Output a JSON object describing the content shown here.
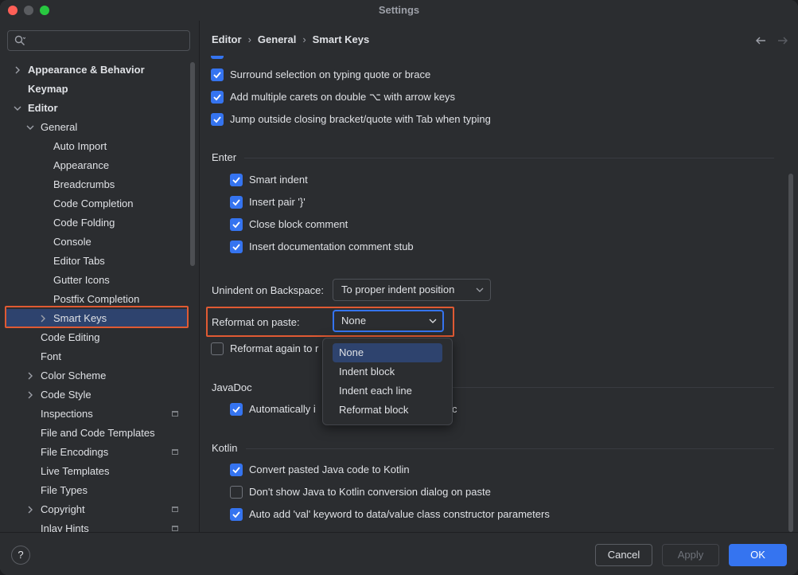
{
  "window": {
    "title": "Settings"
  },
  "search": {
    "placeholder": ""
  },
  "breadcrumb": [
    "Editor",
    "General",
    "Smart Keys"
  ],
  "sidebar": {
    "items": [
      {
        "label": "Appearance & Behavior"
      },
      {
        "label": "Keymap"
      },
      {
        "label": "Editor"
      },
      {
        "label": "General"
      },
      {
        "label": "Auto Import"
      },
      {
        "label": "Appearance"
      },
      {
        "label": "Breadcrumbs"
      },
      {
        "label": "Code Completion"
      },
      {
        "label": "Code Folding"
      },
      {
        "label": "Console"
      },
      {
        "label": "Editor Tabs"
      },
      {
        "label": "Gutter Icons"
      },
      {
        "label": "Postfix Completion"
      },
      {
        "label": "Smart Keys"
      },
      {
        "label": "Code Editing"
      },
      {
        "label": "Font"
      },
      {
        "label": "Color Scheme"
      },
      {
        "label": "Code Style"
      },
      {
        "label": "Inspections"
      },
      {
        "label": "File and Code Templates"
      },
      {
        "label": "File Encodings"
      },
      {
        "label": "Live Templates"
      },
      {
        "label": "File Types"
      },
      {
        "label": "Copyright"
      },
      {
        "label": "Inlay Hints"
      }
    ]
  },
  "options": {
    "surround_selection": {
      "label": "Surround selection on typing quote or brace",
      "checked": true
    },
    "multiple_carets": {
      "label": "Add multiple carets on double ⌥ with arrow keys",
      "checked": true
    },
    "jump_outside": {
      "label": "Jump outside closing bracket/quote with Tab when typing",
      "checked": true
    }
  },
  "enter": {
    "title": "Enter",
    "smart_indent": {
      "label": "Smart indent",
      "checked": true
    },
    "insert_pair": {
      "label": "Insert pair '}'",
      "checked": true
    },
    "close_block_comment": {
      "label": "Close block comment",
      "checked": true
    },
    "insert_doc_stub": {
      "label": "Insert documentation comment stub",
      "checked": true
    }
  },
  "unindent": {
    "label": "Unindent on Backspace:",
    "value": "To proper indent position"
  },
  "reformat": {
    "label": "Reformat on paste:",
    "value": "None",
    "options": [
      "None",
      "Indent block",
      "Indent each line",
      "Reformat block"
    ],
    "again_label": "Reformat again to r",
    "again_checked": false
  },
  "javadoc": {
    "title": "JavaDoc",
    "auto_label_start": "Automatically i",
    "auto_label_end": "c",
    "checked": true
  },
  "kotlin": {
    "title": "Kotlin",
    "convert_java": {
      "label": "Convert pasted Java code to Kotlin",
      "checked": true
    },
    "dont_show_dialog": {
      "label": "Don't show Java to Kotlin conversion dialog on paste",
      "checked": false
    },
    "auto_add_val": {
      "label": "Auto add 'val' keyword to data/value class constructor parameters",
      "checked": true
    }
  },
  "footer": {
    "help": "?",
    "cancel": "Cancel",
    "apply": "Apply",
    "ok": "OK"
  },
  "colors": {
    "accent": "#3574f0",
    "highlight": "#e05a33",
    "selection": "#2e436e"
  }
}
